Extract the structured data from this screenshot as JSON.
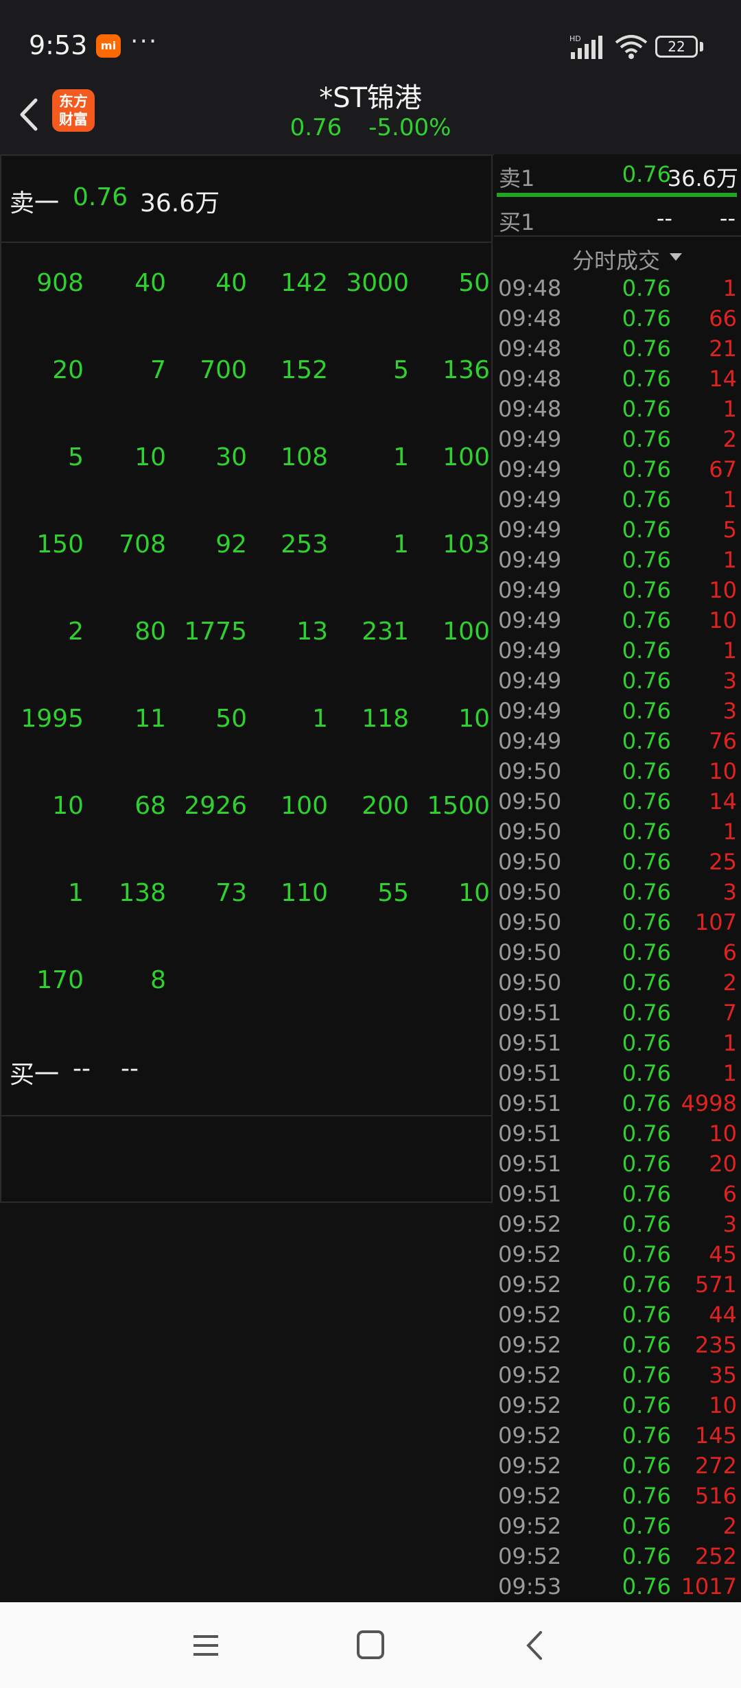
{
  "status_bar": {
    "time": "9:53",
    "mi_badge": "mi",
    "more": "···",
    "battery": "22",
    "icons": [
      "mi-app-icon",
      "more-icon",
      "signal-hd-icon",
      "wifi-icon",
      "battery-icon"
    ]
  },
  "header": {
    "logo_line1": "东方",
    "logo_line2": "财富",
    "title": "*ST锦港",
    "price": "0.76",
    "change_pct": "-5.00%"
  },
  "order_book": {
    "ask_label": "卖一",
    "ask_price": "0.76",
    "ask_volume": "36.6万",
    "ask_queue": [
      [
        "908",
        "40",
        "40",
        "142",
        "3000",
        "50"
      ],
      [
        "20",
        "7",
        "700",
        "152",
        "5",
        "136"
      ],
      [
        "5",
        "10",
        "30",
        "108",
        "1",
        "100"
      ],
      [
        "150",
        "708",
        "92",
        "253",
        "1",
        "103"
      ],
      [
        "2",
        "80",
        "1775",
        "13",
        "231",
        "100"
      ],
      [
        "1995",
        "11",
        "50",
        "1",
        "118",
        "10"
      ],
      [
        "10",
        "68",
        "2926",
        "100",
        "200",
        "1500"
      ],
      [
        "1",
        "138",
        "73",
        "110",
        "55",
        "10"
      ],
      [
        "170",
        "8"
      ]
    ],
    "bid_label": "买一",
    "bid_price": "--",
    "bid_volume": "--"
  },
  "side_quote": {
    "ask_label": "卖1",
    "ask_price": "0.76",
    "ask_volume": "36.6万",
    "ask_bar_fill": 1.0,
    "bid_label": "买1",
    "bid_price": "--",
    "bid_volume": "--",
    "trades_header": "分时成交"
  },
  "trades": [
    {
      "time": "09:48",
      "price": "0.76",
      "vol": "1"
    },
    {
      "time": "09:48",
      "price": "0.76",
      "vol": "66"
    },
    {
      "time": "09:48",
      "price": "0.76",
      "vol": "21"
    },
    {
      "time": "09:48",
      "price": "0.76",
      "vol": "14"
    },
    {
      "time": "09:48",
      "price": "0.76",
      "vol": "1"
    },
    {
      "time": "09:49",
      "price": "0.76",
      "vol": "2"
    },
    {
      "time": "09:49",
      "price": "0.76",
      "vol": "67"
    },
    {
      "time": "09:49",
      "price": "0.76",
      "vol": "1"
    },
    {
      "time": "09:49",
      "price": "0.76",
      "vol": "5"
    },
    {
      "time": "09:49",
      "price": "0.76",
      "vol": "1"
    },
    {
      "time": "09:49",
      "price": "0.76",
      "vol": "10"
    },
    {
      "time": "09:49",
      "price": "0.76",
      "vol": "10"
    },
    {
      "time": "09:49",
      "price": "0.76",
      "vol": "1"
    },
    {
      "time": "09:49",
      "price": "0.76",
      "vol": "3"
    },
    {
      "time": "09:49",
      "price": "0.76",
      "vol": "3"
    },
    {
      "time": "09:49",
      "price": "0.76",
      "vol": "76"
    },
    {
      "time": "09:50",
      "price": "0.76",
      "vol": "10"
    },
    {
      "time": "09:50",
      "price": "0.76",
      "vol": "14"
    },
    {
      "time": "09:50",
      "price": "0.76",
      "vol": "1"
    },
    {
      "time": "09:50",
      "price": "0.76",
      "vol": "25"
    },
    {
      "time": "09:50",
      "price": "0.76",
      "vol": "3"
    },
    {
      "time": "09:50",
      "price": "0.76",
      "vol": "107"
    },
    {
      "time": "09:50",
      "price": "0.76",
      "vol": "6"
    },
    {
      "time": "09:50",
      "price": "0.76",
      "vol": "2"
    },
    {
      "time": "09:51",
      "price": "0.76",
      "vol": "7"
    },
    {
      "time": "09:51",
      "price": "0.76",
      "vol": "1"
    },
    {
      "time": "09:51",
      "price": "0.76",
      "vol": "1"
    },
    {
      "time": "09:51",
      "price": "0.76",
      "vol": "4998"
    },
    {
      "time": "09:51",
      "price": "0.76",
      "vol": "10"
    },
    {
      "time": "09:51",
      "price": "0.76",
      "vol": "20"
    },
    {
      "time": "09:51",
      "price": "0.76",
      "vol": "6"
    },
    {
      "time": "09:52",
      "price": "0.76",
      "vol": "3"
    },
    {
      "time": "09:52",
      "price": "0.76",
      "vol": "45"
    },
    {
      "time": "09:52",
      "price": "0.76",
      "vol": "571"
    },
    {
      "time": "09:52",
      "price": "0.76",
      "vol": "44"
    },
    {
      "time": "09:52",
      "price": "0.76",
      "vol": "235"
    },
    {
      "time": "09:52",
      "price": "0.76",
      "vol": "35"
    },
    {
      "time": "09:52",
      "price": "0.76",
      "vol": "10"
    },
    {
      "time": "09:52",
      "price": "0.76",
      "vol": "145"
    },
    {
      "time": "09:52",
      "price": "0.76",
      "vol": "272"
    },
    {
      "time": "09:52",
      "price": "0.76",
      "vol": "516"
    },
    {
      "time": "09:52",
      "price": "0.76",
      "vol": "2"
    },
    {
      "time": "09:52",
      "price": "0.76",
      "vol": "252"
    },
    {
      "time": "09:53",
      "price": "0.76",
      "vol": "1017"
    }
  ],
  "system_nav": {
    "icons": [
      "menu-icon",
      "home-icon",
      "back-icon"
    ]
  },
  "colors": {
    "up_green": "#2ed12e",
    "sell_red": "#e0231f",
    "background": "#121212",
    "brand_orange": "#f45a1e"
  }
}
